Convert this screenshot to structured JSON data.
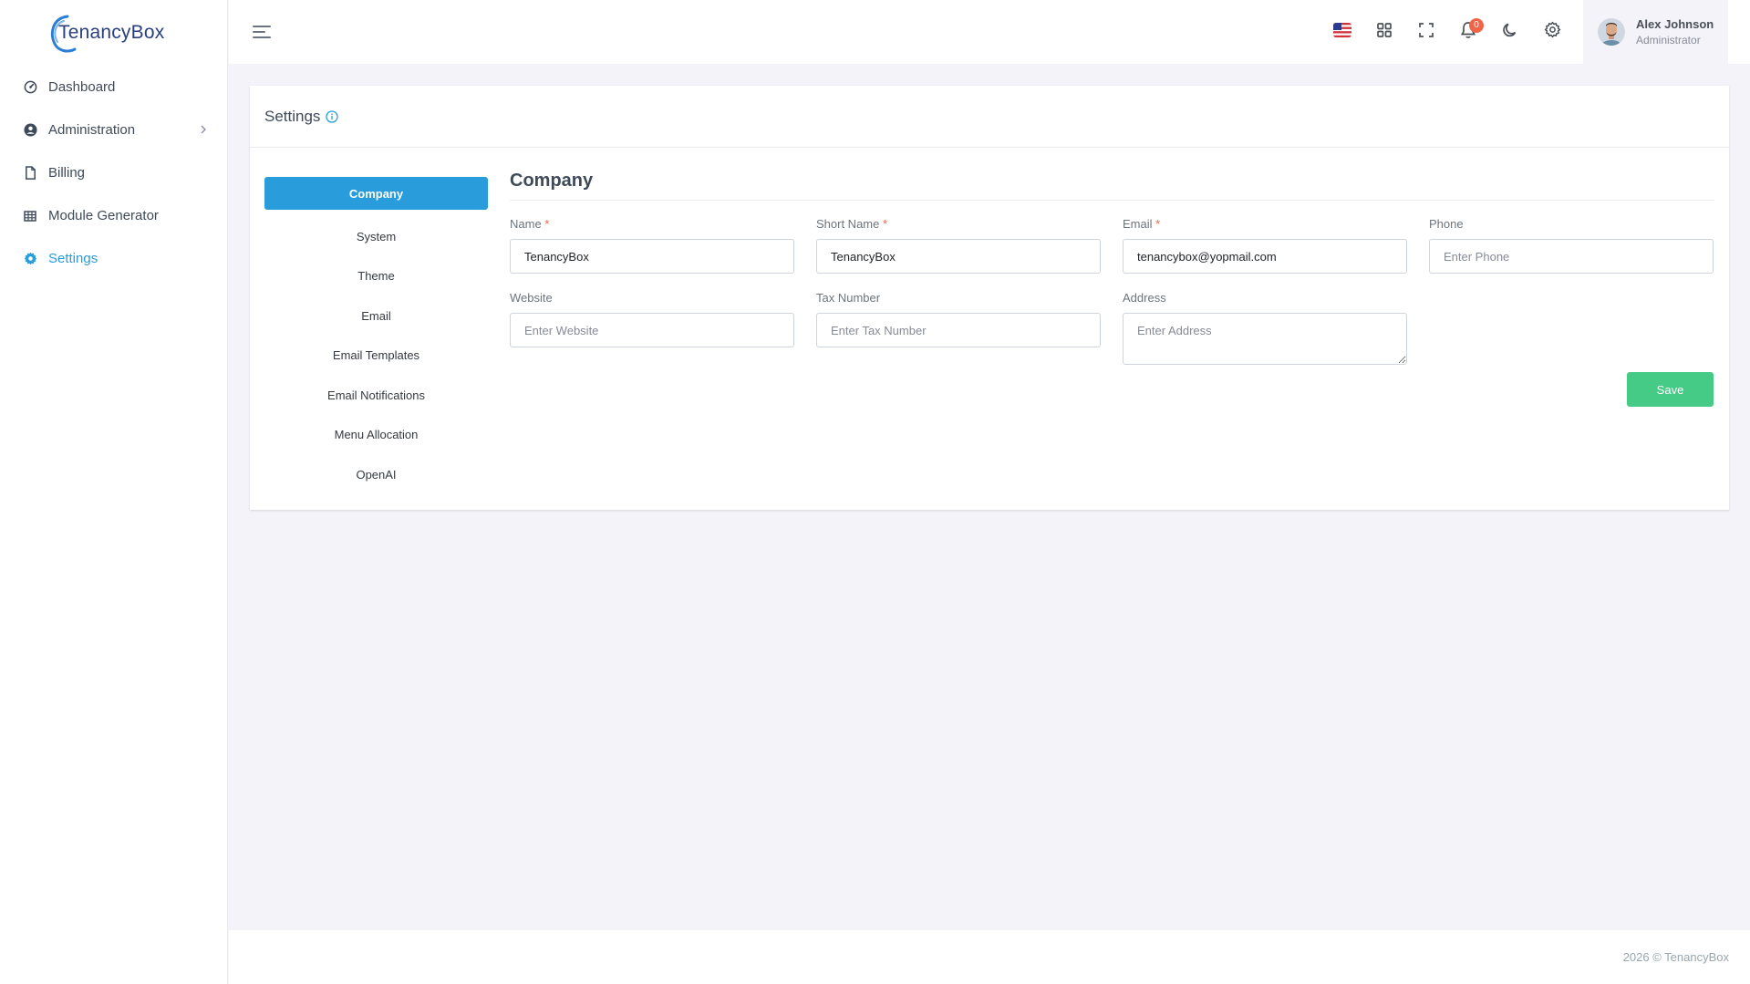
{
  "brand": {
    "name": "TenancyBox"
  },
  "sidebar": {
    "items": [
      {
        "label": "Dashboard",
        "icon": "dashboard-gauge-icon",
        "active": false
      },
      {
        "label": "Administration",
        "icon": "user-circle-icon",
        "active": false,
        "has_children": true
      },
      {
        "label": "Billing",
        "icon": "file-icon",
        "active": false
      },
      {
        "label": "Module Generator",
        "icon": "table-grid-icon",
        "active": false
      },
      {
        "label": "Settings",
        "icon": "gear-icon",
        "active": true
      }
    ]
  },
  "topbar": {
    "notifications_count": "0",
    "user": {
      "name": "Alex Johnson",
      "role": "Administrator"
    },
    "icons": [
      "us-flag-icon",
      "apps-grid-icon",
      "fullscreen-icon",
      "bell-icon",
      "moon-icon",
      "gear-icon"
    ]
  },
  "page": {
    "title": "Settings",
    "tabs": [
      "Company",
      "System",
      "Theme",
      "Email",
      "Email Templates",
      "Email Notifications",
      "Menu Allocation",
      "OpenAI"
    ],
    "active_tab": "Company",
    "panel_title": "Company",
    "form": {
      "name": {
        "label": "Name",
        "required": true,
        "value": "TenancyBox",
        "placeholder": ""
      },
      "short_name": {
        "label": "Short Name",
        "required": true,
        "value": "TenancyBox",
        "placeholder": ""
      },
      "email": {
        "label": "Email",
        "required": true,
        "value": "tenancybox@yopmail.com",
        "placeholder": ""
      },
      "phone": {
        "label": "Phone",
        "required": false,
        "value": "",
        "placeholder": "Enter Phone"
      },
      "website": {
        "label": "Website",
        "required": false,
        "value": "",
        "placeholder": "Enter Website"
      },
      "tax_number": {
        "label": "Tax Number",
        "required": false,
        "value": "",
        "placeholder": "Enter Tax Number"
      },
      "address": {
        "label": "Address",
        "required": false,
        "value": "",
        "placeholder": "Enter Address"
      }
    },
    "save_label": "Save",
    "required_mark": "*"
  },
  "footer": {
    "text": "2026 © TenancyBox"
  },
  "colors": {
    "primary": "#299cdb",
    "success": "#45cb85",
    "danger": "#f06548",
    "brand_text": "#2a3f80"
  }
}
